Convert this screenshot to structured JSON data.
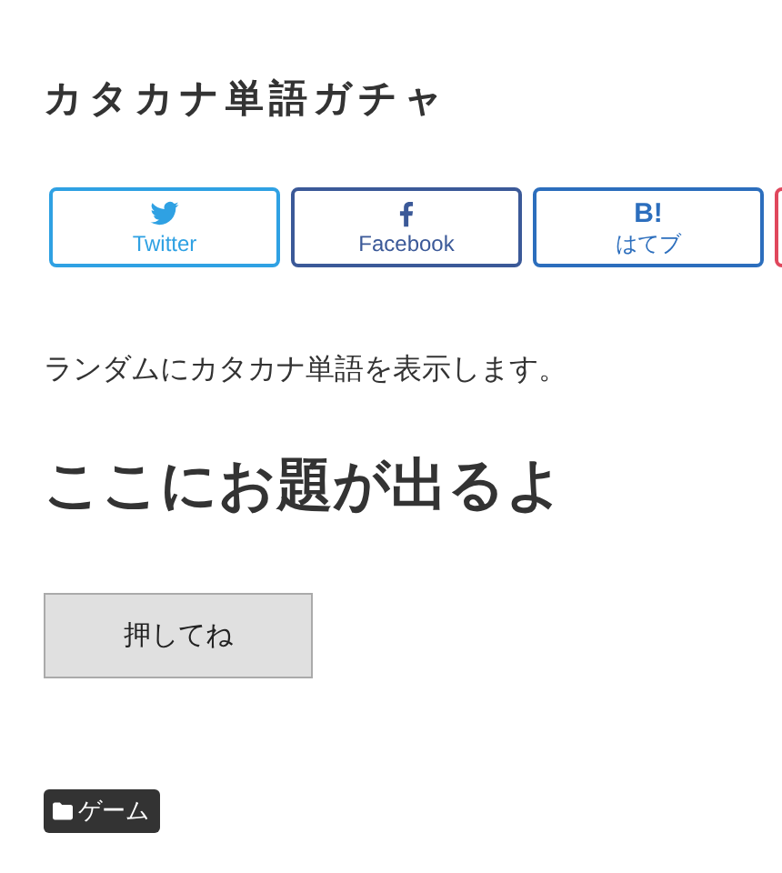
{
  "title": "カタカナ単語ガチャ",
  "share_buttons": [
    {
      "kind": "twitter",
      "label": "Twitter"
    },
    {
      "kind": "facebook",
      "label": "Facebook"
    },
    {
      "kind": "hatena",
      "label": "はてブ",
      "icon_text": "B!"
    },
    {
      "kind": "cut"
    }
  ],
  "description": "ランダムにカタカナ単語を表示します。",
  "result": "ここにお題が出るよ",
  "button": "押してね",
  "category_tag": "ゲーム"
}
